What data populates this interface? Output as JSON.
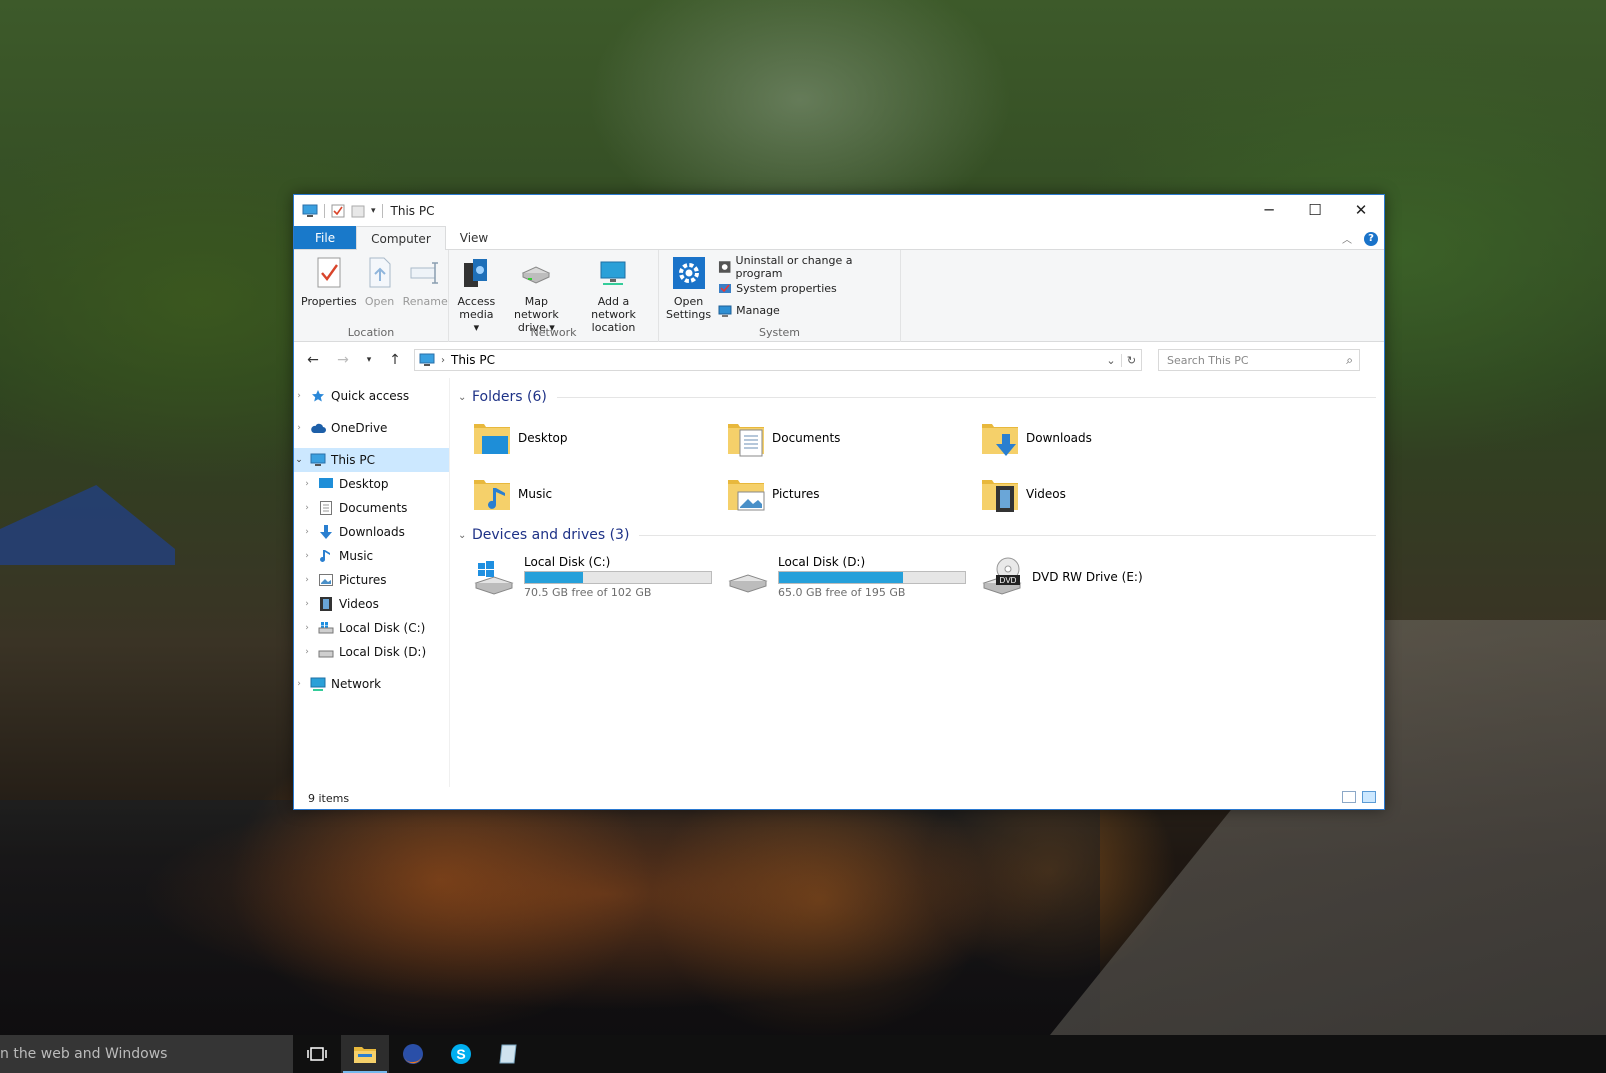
{
  "window": {
    "title": "This PC",
    "minimize": "─",
    "maximize": "☐",
    "close": "✕"
  },
  "tabs": [
    {
      "label": "File"
    },
    {
      "label": "Computer"
    },
    {
      "label": "View"
    }
  ],
  "ribbon": {
    "location": {
      "label": "Location",
      "buttons": [
        {
          "label": "Properties",
          "icon": "properties-icon"
        },
        {
          "label": "Open",
          "icon": "open-icon"
        },
        {
          "label": "Rename",
          "icon": "rename-icon"
        }
      ]
    },
    "network": {
      "label": "Network",
      "buttons": [
        {
          "line1": "Access",
          "line2": "media ▾",
          "icon": "access-media-icon"
        },
        {
          "line1": "Map network",
          "line2": "drive ▾",
          "icon": "map-drive-icon"
        },
        {
          "line1": "Add a network",
          "line2": "location",
          "icon": "network-location-icon"
        }
      ]
    },
    "system": {
      "label": "System",
      "open_settings": {
        "line1": "Open",
        "line2": "Settings"
      },
      "items": [
        {
          "label": "Uninstall or change a program"
        },
        {
          "label": "System properties"
        },
        {
          "label": "Manage"
        }
      ]
    }
  },
  "address": {
    "path": "This PC",
    "search_placeholder": "Search This PC"
  },
  "nav": {
    "quick_access": "Quick access",
    "onedrive": "OneDrive",
    "this_pc": "This PC",
    "children": [
      {
        "label": "Desktop"
      },
      {
        "label": "Documents"
      },
      {
        "label": "Downloads"
      },
      {
        "label": "Music"
      },
      {
        "label": "Pictures"
      },
      {
        "label": "Videos"
      },
      {
        "label": "Local Disk (C:)"
      },
      {
        "label": "Local Disk (D:)"
      }
    ],
    "network": "Network"
  },
  "folders": {
    "header": "Folders (6)",
    "items": [
      {
        "label": "Desktop",
        "icon": "desktop-folder-icon"
      },
      {
        "label": "Documents",
        "icon": "documents-folder-icon"
      },
      {
        "label": "Downloads",
        "icon": "downloads-folder-icon"
      },
      {
        "label": "Music",
        "icon": "music-folder-icon"
      },
      {
        "label": "Pictures",
        "icon": "pictures-folder-icon"
      },
      {
        "label": "Videos",
        "icon": "videos-folder-icon"
      }
    ]
  },
  "drives": {
    "header": "Devices and drives (3)",
    "items": [
      {
        "label": "Local Disk (C:)",
        "free": "70.5 GB free of 102 GB",
        "used_fraction": 0.31
      },
      {
        "label": "Local Disk (D:)",
        "free": "65.0 GB free of 195 GB",
        "used_fraction": 0.667
      },
      {
        "label": "DVD RW Drive (E:)",
        "dvd_badge": "DVD"
      }
    ]
  },
  "status": {
    "items": "9 items"
  },
  "taskbar": {
    "search": "n the web and Windows"
  },
  "colors": {
    "accent": "#1979ca",
    "drive_bar": "#26a0da",
    "selection": "#cce8ff",
    "folder": "#f2c94c"
  }
}
